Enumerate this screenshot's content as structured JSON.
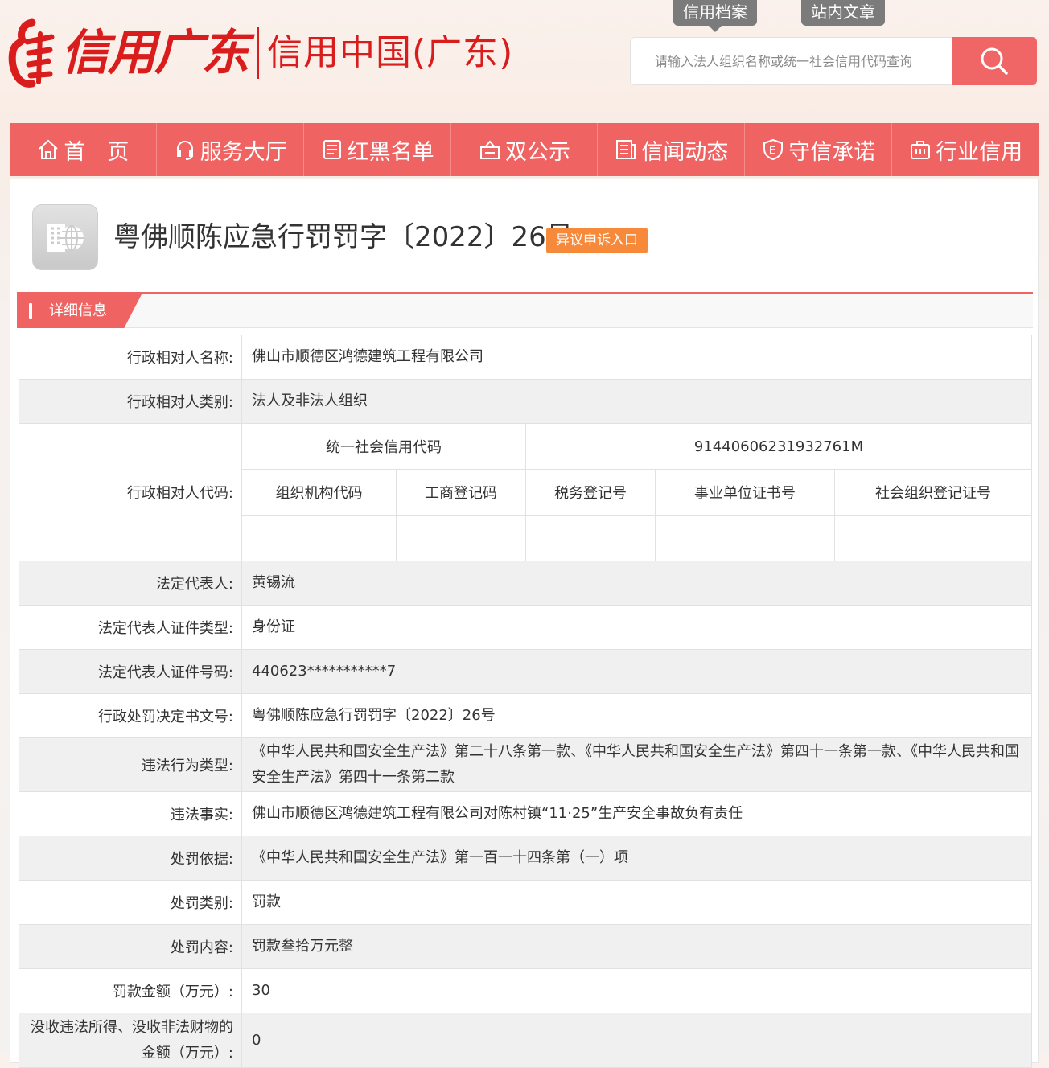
{
  "header": {
    "logo_script": "信用广东",
    "logo_text": "信用中国(广东)",
    "top_tabs": [
      "信用档案",
      "站内文章"
    ],
    "search_placeholder": "请输入法人组织名称或统一社会信用代码查询"
  },
  "nav": {
    "items": [
      {
        "label": "首　页",
        "icon": "home-icon"
      },
      {
        "label": "服务大厅",
        "icon": "headset-icon"
      },
      {
        "label": "红黑名单",
        "icon": "list-icon"
      },
      {
        "label": "双公示",
        "icon": "announce-icon"
      },
      {
        "label": "信闻动态",
        "icon": "news-icon"
      },
      {
        "label": "守信承诺",
        "icon": "shield-icon"
      },
      {
        "label": "行业信用",
        "icon": "briefcase-icon"
      }
    ]
  },
  "doc": {
    "title": "粤佛顺陈应急行罚罚字〔2022〕26号",
    "appeal_label": "异议申诉入口",
    "section_label": "详细信息"
  },
  "details": {
    "name_label": "行政相对人名称:",
    "name_value": "佛山市顺德区鸿德建筑工程有限公司",
    "type_label": "行政相对人类别:",
    "type_value": "法人及非法人组织",
    "code_label": "行政相对人代码:",
    "codes": {
      "uscc_label": "统一社会信用代码",
      "uscc_value": "91440606231932761M",
      "org_code_label": "组织机构代码",
      "biz_reg_label": "工商登记码",
      "tax_reg_label": "税务登记号",
      "inst_cert_label": "事业单位证书号",
      "social_org_label": "社会组织登记证号"
    },
    "legal_rep_label": "法定代表人:",
    "legal_rep_value": "黄锡流",
    "id_type_label": "法定代表人证件类型:",
    "id_type_value": "身份证",
    "id_no_label": "法定代表人证件号码:",
    "id_no_value": "440623***********7",
    "decision_no_label": "行政处罚决定书文号:",
    "decision_no_value": "粤佛顺陈应急行罚罚字〔2022〕26号",
    "violation_type_label": "违法行为类型:",
    "violation_type_value": "《中华人民共和国安全生产法》第二十八条第一款、《中华人民共和国安全生产法》第四十一条第一款、《中华人民共和国安全生产法》第四十一条第二款",
    "facts_label": "违法事实:",
    "facts_value": "佛山市顺德区鸿德建筑工程有限公司对陈村镇“11·25”生产安全事故负有责任",
    "basis_label": "处罚依据:",
    "basis_value": "《中华人民共和国安全生产法》第一百一十四条第（一）项",
    "category_label": "处罚类别:",
    "category_value": "罚款",
    "content_label": "处罚内容:",
    "content_value": "罚款叁拾万元整",
    "fine_label": "罚款金额（万元）:",
    "fine_value": "30",
    "confiscation_label": "没收违法所得、没收非法财物的金额（万元）:",
    "confiscation_value": "0"
  }
}
